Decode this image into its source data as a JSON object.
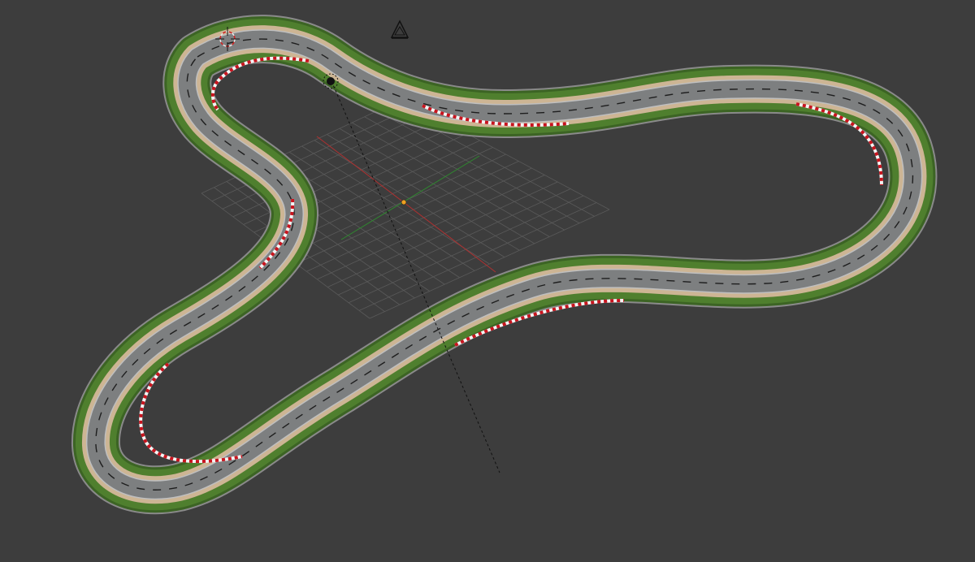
{
  "viewport": {
    "background_color": "#3d3d3d",
    "grid_color": "#5a5a5a",
    "x_axis_color": "#b03030",
    "y_axis_color": "#2f8a2f"
  },
  "scene": {
    "track": {
      "grass_color": "#4f7f2e",
      "grass_dark_color": "#3c6424",
      "edge_color": "#8a8a8a",
      "sand_color": "#cdb594",
      "asphalt_color": "#7d7f80",
      "center_line_color": "#1e1e1e",
      "curb_red": "#c8141e",
      "curb_white": "#f4f4f4"
    },
    "objects": {
      "cursor_icon": "3d-cursor-icon",
      "camera_icon": "camera-icon",
      "lamp_icon": "lamp-icon",
      "origin_color": "#f0a020"
    }
  }
}
